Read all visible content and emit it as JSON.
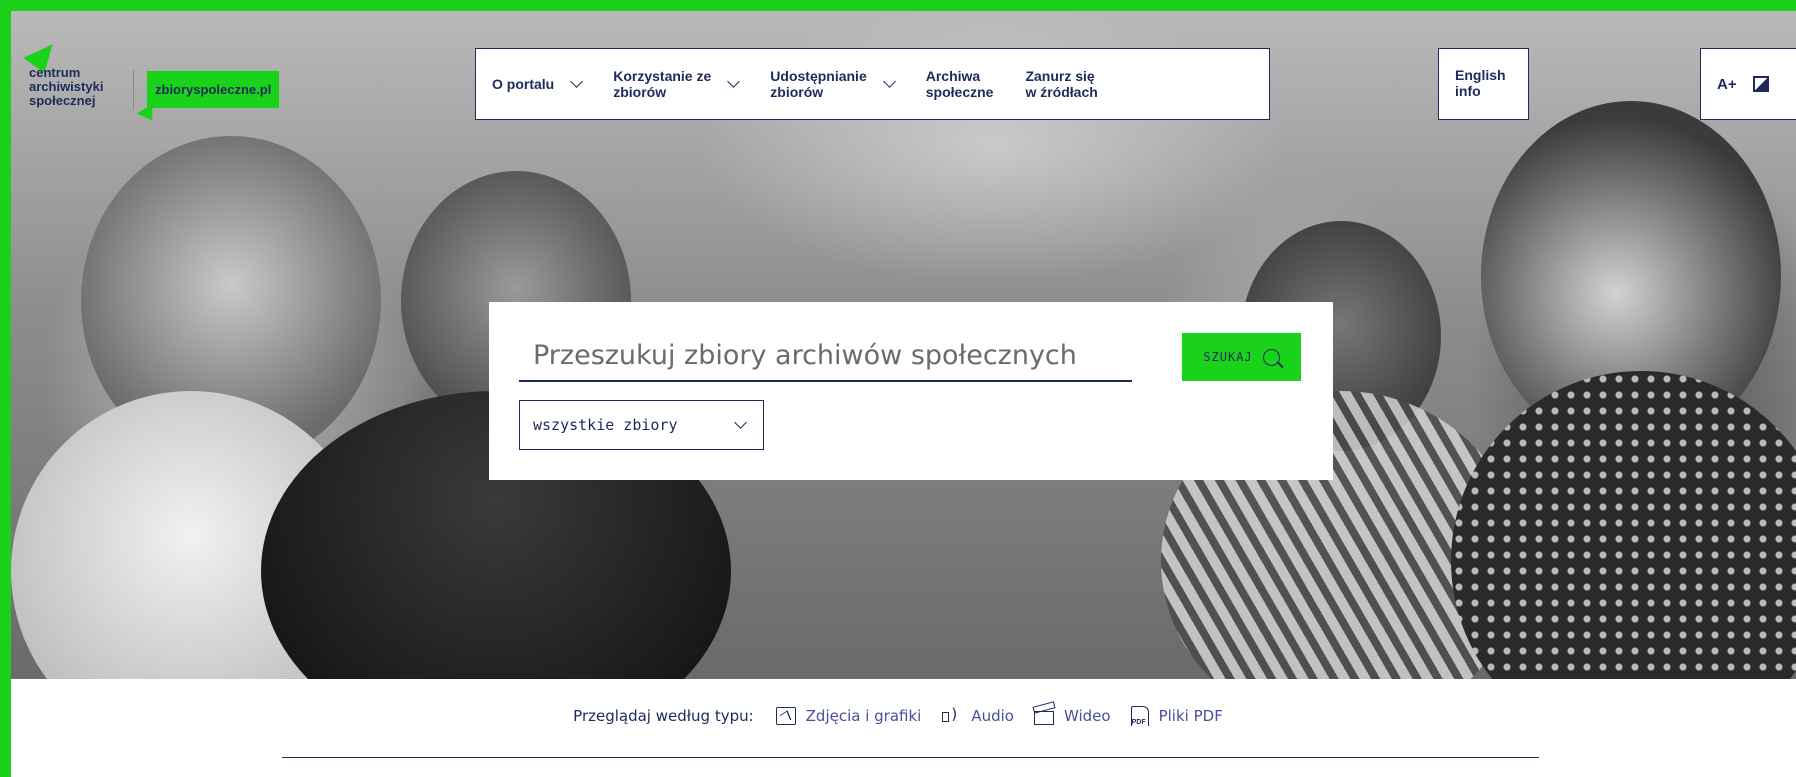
{
  "brand": {
    "org_name": "centrum\narchiwistyki\nspołecznej",
    "site_name": "zbioryspoleczne.pl",
    "accent_color": "#19d219",
    "text_color": "#1f2a5c"
  },
  "nav": {
    "items": [
      {
        "label": "O portalu",
        "has_dropdown": true
      },
      {
        "label": "Korzystanie ze\nzbiorów",
        "has_dropdown": true
      },
      {
        "label": "Udostępnianie\nzbiorów",
        "has_dropdown": true
      },
      {
        "label": "Archiwa\nspołeczne",
        "has_dropdown": false
      },
      {
        "label": "Zanurz się\nw źródłach",
        "has_dropdown": false
      }
    ],
    "english_label": "English\ninfo",
    "font_size_label": "A+",
    "contrast_icon": "contrast-icon"
  },
  "search": {
    "placeholder": "Przeszukuj zbiory archiwów społecznych",
    "button_label": "SZUKAJ",
    "scope_value": "wszystkie zbiory"
  },
  "browse": {
    "lead": "Przeglądaj według typu:",
    "types": [
      {
        "label": "Zdjęcia i grafiki",
        "icon": "image-icon"
      },
      {
        "label": "Audio",
        "icon": "audio-icon"
      },
      {
        "label": "Wideo",
        "icon": "video-icon"
      },
      {
        "label": "Pliki PDF",
        "icon": "pdf-icon"
      }
    ]
  }
}
